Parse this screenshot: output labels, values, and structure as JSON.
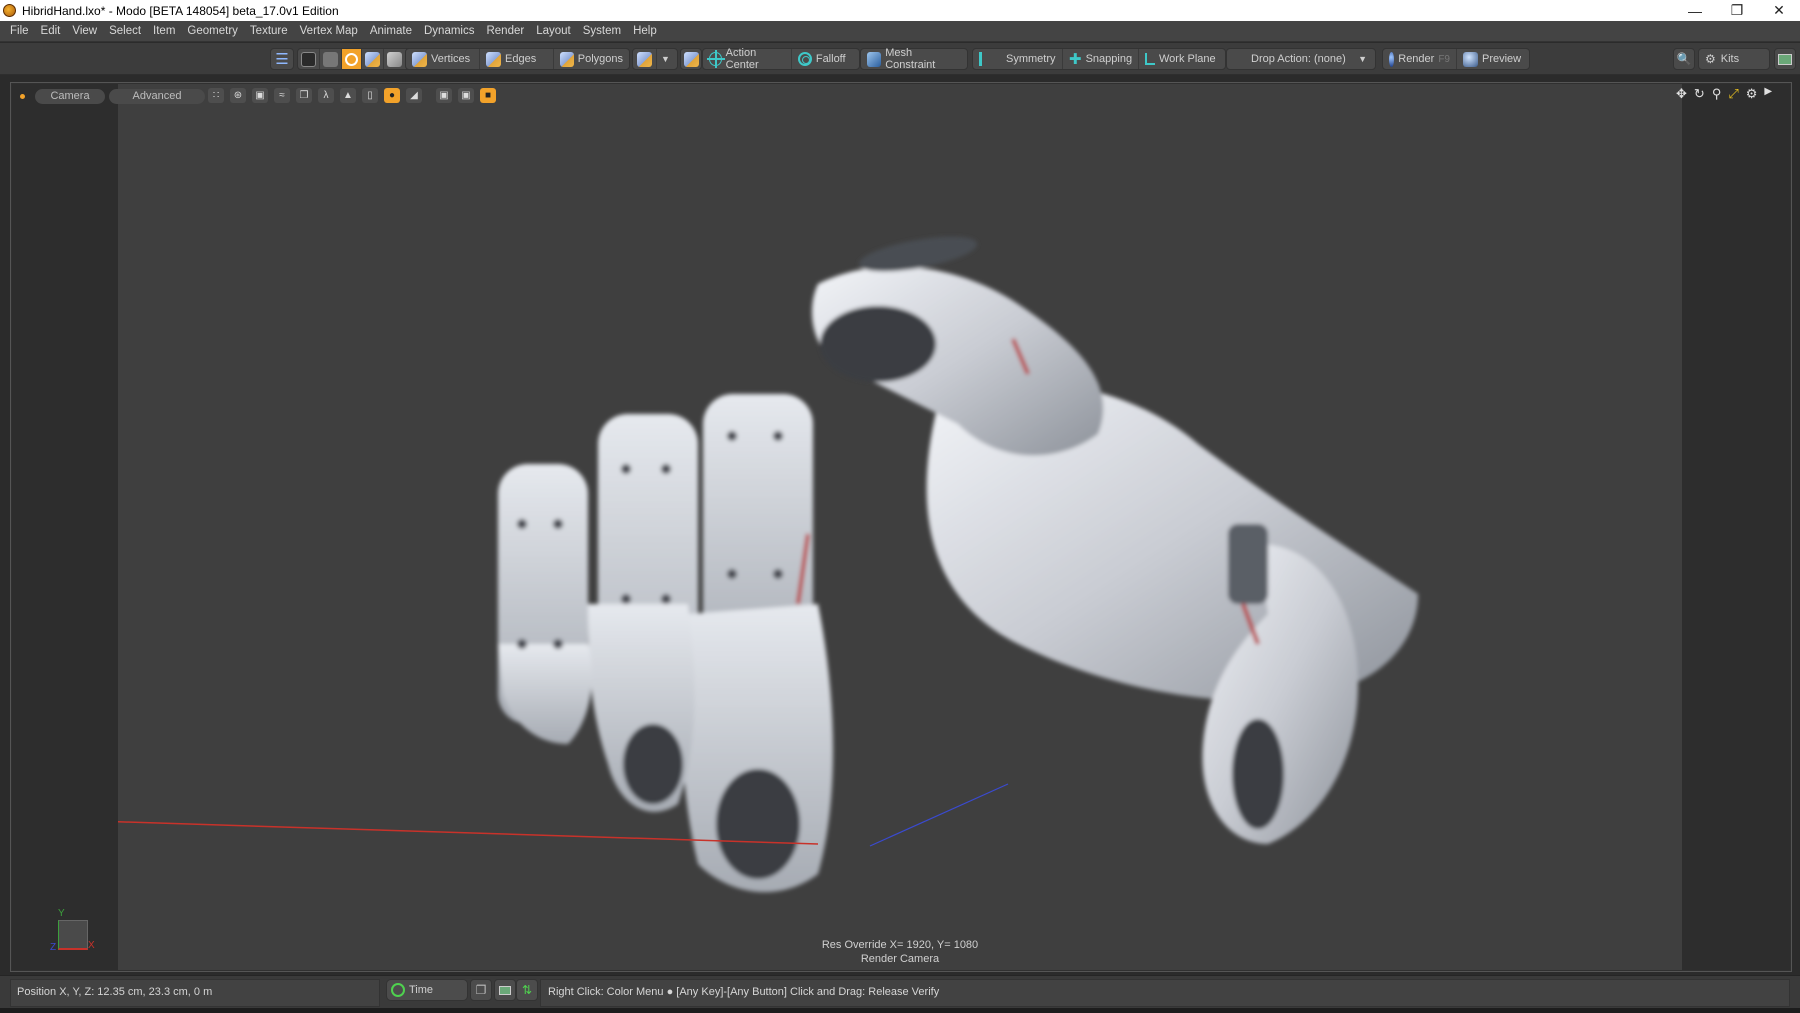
{
  "window": {
    "title": "HibridHand.lxo* - Modo [BETA 148054]   beta_17.0v1 Edition",
    "controls": [
      "minimize",
      "restore",
      "close"
    ]
  },
  "menu": [
    "File",
    "Edit",
    "View",
    "Select",
    "Item",
    "Geometry",
    "Texture",
    "Vertex Map",
    "Animate",
    "Dynamics",
    "Render",
    "Layout",
    "System",
    "Help"
  ],
  "toolbar": {
    "vertices": "Vertices",
    "edges": "Edges",
    "polygons": "Polygons",
    "action_center": "Action Center",
    "falloff": "Falloff",
    "mesh_constraint": "Mesh Constraint",
    "symmetry": "Symmetry",
    "snapping": "Snapping",
    "work_plane": "Work Plane",
    "drop_action": "Drop Action: (none)",
    "render": "Render",
    "render_shortcut": "F9",
    "preview": "Preview",
    "kits": "Kits"
  },
  "viewport": {
    "camera_tab": "Camera",
    "advanced_tab": "Advanced",
    "overlay_line1": "Res Override  X= 1920, Y= 1080",
    "overlay_line2": "Render Camera",
    "axis_labels": {
      "x": "X",
      "y": "Y",
      "z": "Z"
    },
    "colors": {
      "accent": "#f2a22a",
      "background": "#3f3f3f",
      "x_axis": "#c8322a",
      "y_axis": "#3ca03c",
      "z_axis": "#3a4ad0"
    }
  },
  "status": {
    "position": "Position X, Y, Z:   12.35 cm, 23.3 cm, 0 m",
    "time_label": "Time",
    "hint": "Right Click: Color Menu ● [Any Key]-[Any Button] Click and Drag: Release Verify"
  }
}
